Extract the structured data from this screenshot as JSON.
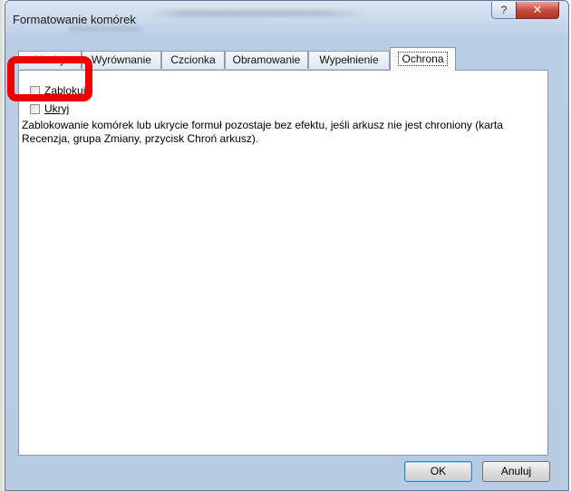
{
  "window": {
    "title": "Formatowanie komórek",
    "help_glyph": "?",
    "close_glyph": "✕"
  },
  "tabs": [
    {
      "label": "Liczby"
    },
    {
      "label": "Wyrównanie"
    },
    {
      "label": "Czcionka"
    },
    {
      "label": "Obramowanie"
    },
    {
      "label": "Wypełnienie"
    },
    {
      "label": "Ochrona"
    }
  ],
  "protection": {
    "lock_label": "Zablokuj",
    "hide_label": "Ukryj",
    "description": "Zablokowanie komórek lub ukrycie formuł pozostaje bez efektu, jeśli arkusz nie jest chroniony (karta Recenzja, grupa Zmiany, przycisk Chroń arkusz).",
    "lock_checked": false,
    "hide_checked": false
  },
  "buttons": {
    "ok": "OK",
    "cancel": "Anuluj"
  },
  "colors": {
    "highlight": "#ee0000",
    "close_button": "#c8473a"
  }
}
